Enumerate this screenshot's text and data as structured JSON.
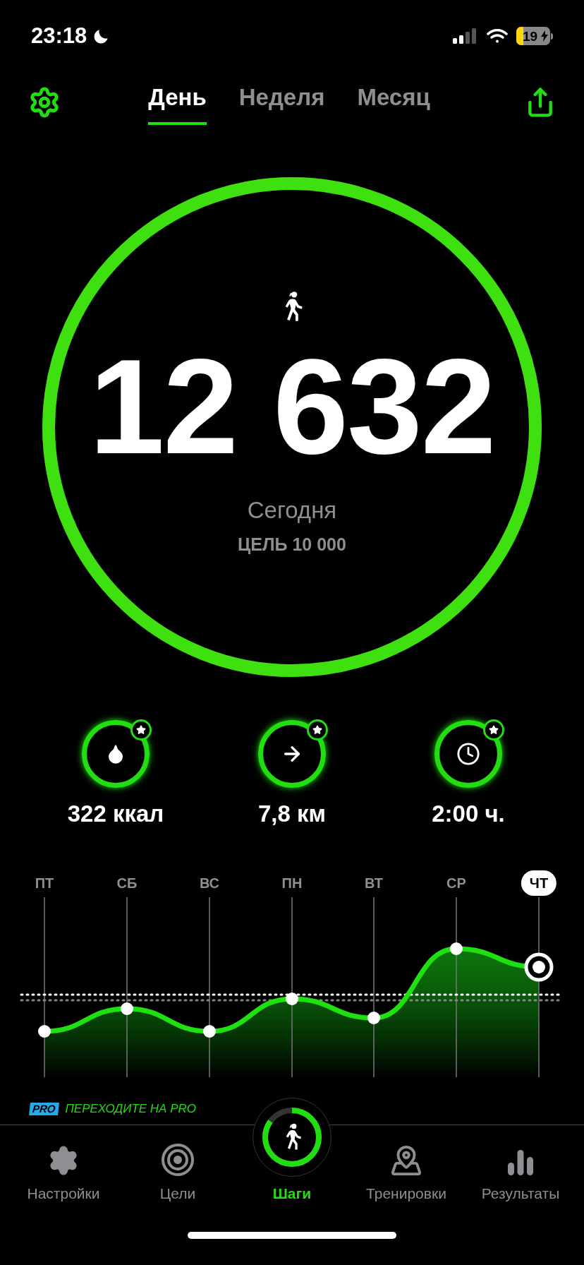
{
  "status_bar": {
    "time": "23:18",
    "battery": "19"
  },
  "tabs": [
    {
      "label": "День",
      "selected": true
    },
    {
      "label": "Неделя",
      "selected": false
    },
    {
      "label": "Месяц",
      "selected": false
    }
  ],
  "progress": {
    "level": 1,
    "steps": "12 632",
    "caption": "Сегодня",
    "goal": "ЦЕЛЬ 10 000"
  },
  "stats": [
    {
      "kind": "calories",
      "value": "322 ккал"
    },
    {
      "kind": "distance",
      "value": "7,8 км"
    },
    {
      "kind": "time",
      "value": "2:00 ч."
    }
  ],
  "days": [
    {
      "label": "ПТ",
      "selected": false
    },
    {
      "label": "СБ",
      "selected": false
    },
    {
      "label": "ВС",
      "selected": false
    },
    {
      "label": "ПН",
      "selected": false
    },
    {
      "label": "ВТ",
      "selected": false
    },
    {
      "label": "СР",
      "selected": false
    },
    {
      "label": "ЧТ",
      "selected": true
    }
  ],
  "promo": {
    "badge": "PRO",
    "text": "ПЕРЕХОДИТЕ НА PRO"
  },
  "nav": [
    {
      "kind": "settings",
      "label": "Настройки",
      "selected": false
    },
    {
      "kind": "goals",
      "label": "Цели",
      "selected": false
    },
    {
      "kind": "steps",
      "label": "Шаги",
      "selected": true,
      "level": 0.85
    },
    {
      "kind": "workouts",
      "label": "Тренировки",
      "selected": false
    },
    {
      "kind": "results",
      "label": "Результаты",
      "selected": false
    }
  ]
}
